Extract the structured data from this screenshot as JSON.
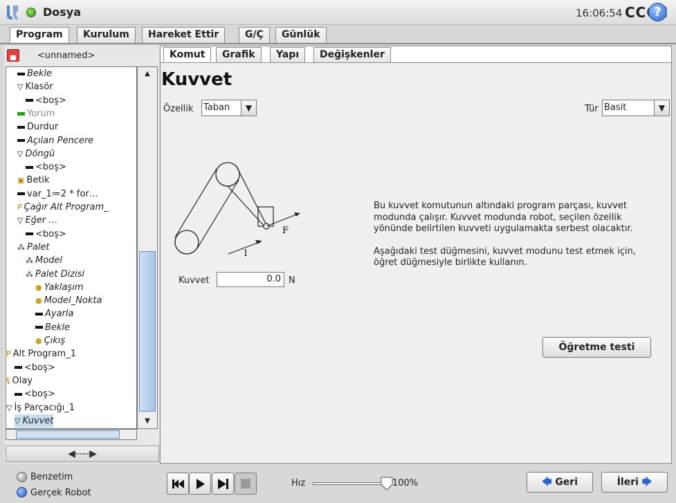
{
  "titlebar": {
    "app_name": "Dosya",
    "time": "16:06:54",
    "robot_name": "CCCC",
    "help_label": "?"
  },
  "main_tabs": [
    "Program",
    "Kurulum",
    "Hareket Ettir",
    "G/Ç",
    "Günlük"
  ],
  "left": {
    "file_name": "<unnamed>",
    "tree": [
      {
        "label": "Bekle",
        "style": "i",
        "icon": "bar"
      },
      {
        "label": "Klasör",
        "style": "bi",
        "icon": "tri"
      },
      {
        "label": "<boş>",
        "style": "gi",
        "icon": "bar"
      },
      {
        "label": "Yorum",
        "style": "g",
        "icon": "gbar"
      },
      {
        "label": "Durdur",
        "style": "",
        "icon": "bar"
      },
      {
        "label": "Açılan Pencere",
        "style": "i",
        "icon": "bar"
      },
      {
        "label": "Döngü",
        "style": "i",
        "icon": "tri"
      },
      {
        "label": "<boş>",
        "style": "gi",
        "icon": "bar"
      },
      {
        "label": "Betik",
        "style": "bi",
        "icon": "script"
      },
      {
        "label": "var_1≔2 * for…",
        "style": "",
        "icon": "bar"
      },
      {
        "label": "Çağır Alt Program_",
        "style": "i",
        "icon": "sub"
      },
      {
        "label": "Eğer …",
        "style": "i",
        "icon": "tri"
      },
      {
        "label": "<boş>",
        "style": "gi",
        "icon": "bar"
      },
      {
        "label": "Palet",
        "style": "i",
        "icon": "pal"
      },
      {
        "label": "Model",
        "style": "i",
        "icon": "pal"
      },
      {
        "label": "Palet Dizisi",
        "style": "i",
        "icon": "pal"
      },
      {
        "label": "Yaklaşım",
        "style": "i",
        "icon": "dot"
      },
      {
        "label": "Model_Nokta",
        "style": "i",
        "icon": "dot"
      },
      {
        "label": "Ayarla",
        "style": "i",
        "icon": "bar"
      },
      {
        "label": "Bekle",
        "style": "i",
        "icon": "bar"
      },
      {
        "label": "Çıkış",
        "style": "i",
        "icon": "dot"
      },
      {
        "label": "Alt Program_1",
        "style": "bi",
        "icon": "sub"
      },
      {
        "label": "<boş>",
        "style": "gi",
        "icon": "bar"
      },
      {
        "label": "Olay",
        "style": "bi",
        "icon": "event"
      },
      {
        "label": "<boş>",
        "style": "gi",
        "icon": "bar"
      },
      {
        "label": "İş Parçacığı_1",
        "style": "bi",
        "icon": "tri"
      },
      {
        "label": "Kuvvet",
        "style": "i sel",
        "icon": "tri"
      }
    ],
    "nav_arrow": "◀----▶"
  },
  "sub_tabs": [
    "Komut",
    "Grafik",
    "Yapı",
    "Değişkenler"
  ],
  "force": {
    "title": "Kuvvet",
    "feature_label": "Özellik",
    "feature_value": "Taban",
    "type_label": "Tür",
    "type_value": "Basit",
    "force_label": "Kuvvet",
    "force_value": "0.0",
    "force_unit": "N",
    "diagram_f": "F",
    "diagram_l": "l",
    "desc_1": "Bu kuvvet komutunun altındaki program parçası, kuvvet modunda çalışır. Kuvvet modunda robot, seçilen özellik yönünde belirtilen kuvveti uygulamakta serbest olacaktır.",
    "desc_2": "Aşağıdaki test düğmesini, kuvvet modunu test etmek için, öğret düğmesiyle birlikte kullanın.",
    "teach_button": "Öğretme testi"
  },
  "bottom": {
    "sim_label": "Benzetim",
    "real_label": "Gerçek Robot",
    "speed_label": "Hız",
    "speed_value": "100%",
    "speed_level": 1.0,
    "back_label": "Geri",
    "next_label": "İleri"
  },
  "colors": {
    "accent_blue": "#2c64c8",
    "status_green": "#2f8a10",
    "selection": "#c9ddf0"
  }
}
